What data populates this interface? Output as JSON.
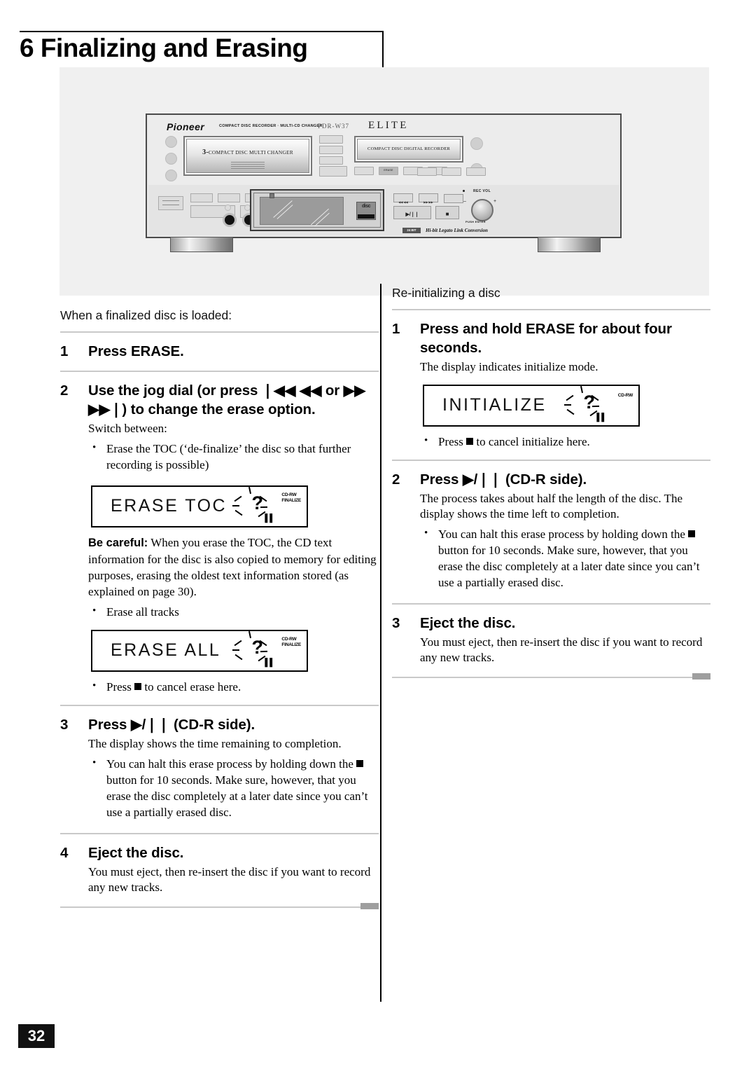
{
  "header": {
    "chapter_title": "6 Finalizing and Erasing"
  },
  "device": {
    "brand": "Pioneer",
    "brand_subtitle": "COMPACT DISC RECORDER · MULTI-CD CHANGER",
    "model": "PDR-W37",
    "series": "ELITE",
    "changer_tray_prefix": "3-",
    "changer_tray_label": "COMPACT DISC MULTI CHANGER",
    "recorder_tray_label": "COMPACT DISC DIGITAL RECORDER",
    "erase_button_label": "ERASE",
    "rec_vol_label": "REC VOL",
    "push_enter_label": "PUSH ENTER",
    "minus_label": "–",
    "plus_label": "+",
    "play_pause_label": "▶/❘❘",
    "stop_label": "■",
    "prev_label": "◀◀ ◀◀",
    "next_label": "▶▶ ▶▶",
    "bit_badge": "24 BIT",
    "legato_label": "Hi-bit Legato Link Conversion",
    "disc_logo_text": "disc"
  },
  "left_column": {
    "lead": "When a finalized disc is loaded:",
    "step1": {
      "num": "1",
      "title": "Press ERASE."
    },
    "step2": {
      "num": "2",
      "title": "Use the jog dial (or press ❘◀◀ ◀◀ or ▶▶ ▶▶❘) to change the erase option.",
      "sub": "Switch between:",
      "bullet1": "Erase the TOC (‘de-finalize’ the disc so that further recording is possible)",
      "bullet2": "Erase all tracks",
      "caution_label": "Be careful:",
      "caution_text": " When you erase the TOC, the CD text information for the disc is also copied to memory for editing purposes, erasing the oldest text information stored (as explained on page 30).",
      "cancel_bullet_pre": "Press ",
      "cancel_bullet_post": " to cancel erase here.",
      "lcd1": {
        "text": "ERASE  TOC",
        "symbol": "?",
        "indicator": "CD-RW\nFINALIZE",
        "bars": "▌▌"
      },
      "lcd2": {
        "text": "ERASE  ALL",
        "symbol": "?",
        "indicator": "CD-RW\nFINALIZE",
        "bars": "▌▌"
      }
    },
    "step3": {
      "num": "3",
      "title": "Press ▶/❘❘ (CD-R side).",
      "sub": "The display shows the time remaining to completion.",
      "bullet_pre": "You can halt this erase process by holding down the ",
      "bullet_post": " button for 10 seconds. Make sure, however, that you erase the disc completely at a later date since you can’t use a partially erased disc."
    },
    "step4": {
      "num": "4",
      "title": "Eject the disc.",
      "sub": "You must eject, then re-insert the disc if you want to record any new tracks."
    }
  },
  "right_column": {
    "lead": "Re-initializing a disc",
    "step1": {
      "num": "1",
      "title": "Press and hold ERASE for about four seconds.",
      "sub": "The  display indicates initialize mode.",
      "cancel_bullet_pre": "Press ",
      "cancel_bullet_post": " to cancel initialize here.",
      "lcd": {
        "text": "INITIALIZE",
        "symbol": "?",
        "indicator": "CD-RW",
        "bars": "▌▌"
      }
    },
    "step2": {
      "num": "2",
      "title": "Press ▶/❘❘ (CD-R side).",
      "sub": "The process takes about half the length of the disc. The display shows the time left to completion.",
      "bullet_pre": "You can halt this erase process by holding down the ",
      "bullet_post": " button for 10 seconds. Make sure, however, that you erase the disc completely at a later date since you can’t use a partially erased disc."
    },
    "step3": {
      "num": "3",
      "title": "Eject the disc.",
      "sub": "You must eject, then re-insert the disc if you want to record any new tracks."
    }
  },
  "footer": {
    "page_number": "32"
  }
}
